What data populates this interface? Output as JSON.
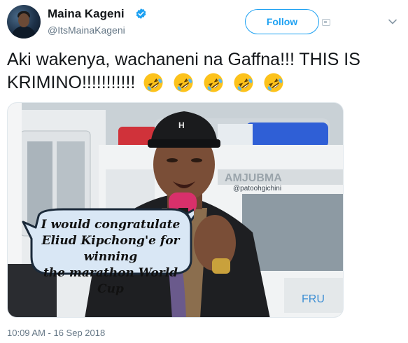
{
  "author": {
    "display_name": "Maina Kageni",
    "handle": "@ItsMainaKageni",
    "verified": true
  },
  "actions": {
    "follow_label": "Follow"
  },
  "tweet": {
    "text_line1": "Aki wakenya, wachaneni na Gaffna!!!  THIS IS",
    "text_line2": "KRIMINO!!!!!!!!!!!",
    "emojis": [
      "rolling-on-floor-laughing",
      "rolling-on-floor-laughing",
      "rolling-on-floor-laughing",
      "rolling-on-floor-laughing",
      "rolling-on-floor-laughing"
    ],
    "timestamp": "10:09 AM - 16 Sep 2018"
  },
  "media": {
    "watermark": "@patoohgichini",
    "caption_lines": [
      "I would congratulate",
      "Eliud Kipchong'e for winning",
      "the marathon World Cup"
    ]
  },
  "colors": {
    "twitter_blue": "#1da1f2",
    "verified": "#1da1f2",
    "muted_text": "#657786"
  }
}
